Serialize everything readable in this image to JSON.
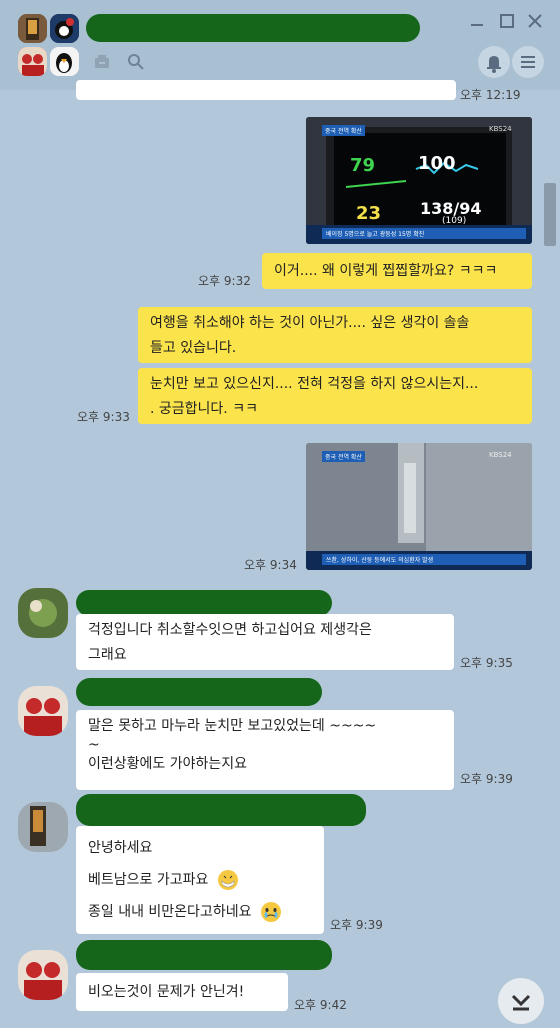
{
  "messages": [
    {
      "id": "m0",
      "type": "text",
      "side": "me",
      "text": "",
      "time": "오후 12:19"
    },
    {
      "id": "m1",
      "type": "image",
      "side": "me",
      "caption": "베이징 5명으로 늘고 광둥성 15명 확진",
      "channel": "KBS24",
      "tag": "중국 전역 확산",
      "values": {
        "hr": "79",
        "spo2": "100",
        "rr": "23",
        "bp": "138/94",
        "map": "(109)"
      }
    },
    {
      "id": "m2",
      "type": "text",
      "side": "me",
      "text": "이거.... 왜 이렇게 찝찝할까요? ㅋㅋㅋ",
      "time": "오후 9:32"
    },
    {
      "id": "m3",
      "type": "text",
      "side": "me",
      "lines": [
        "여행을 취소해야 하는 것이 아닌가.... 싶은 생각이 솔솔",
        "들고 있습니다."
      ]
    },
    {
      "id": "m4",
      "type": "text",
      "side": "me",
      "lines": [
        "눈치만 보고 있으신지.... 전혀 걱정을 하지 않으시는지...",
        ". 궁금합니다. ㅋㅋ"
      ],
      "time": "오후 9:33"
    },
    {
      "id": "m5",
      "type": "image",
      "side": "me",
      "caption": "쓰촨, 상하이, 산둥 등에서도 의심환자 발생",
      "channel": "KBS24",
      "tag": "중국 전역 확산",
      "time": "오후 9:34"
    },
    {
      "id": "m6",
      "type": "text",
      "side": "other",
      "lines": [
        "걱정입니다 취소할수잇으면 하고십어요  제생각은",
        "그래요"
      ],
      "time": "오후 9:35"
    },
    {
      "id": "m7",
      "type": "text",
      "side": "other",
      "lines": [
        "말은 못하고 마누라 눈치만 보고있었는데 ~~~~",
        "~",
        "이런상황에도 가야하는지요"
      ],
      "time": "오후 9:39"
    },
    {
      "id": "m8",
      "type": "text",
      "side": "other",
      "lines": [
        "안녕하세요",
        "베트남으로 가고파요",
        "종일 내내 비만온다고하네요"
      ],
      "emojis": [
        "mask-face-icon",
        "crying-face-icon"
      ],
      "time": "오후 9:39"
    },
    {
      "id": "m9",
      "type": "text",
      "side": "other",
      "text": "비오는것이 문제가 안닌겨!",
      "time": "오후 9:42"
    }
  ],
  "colors": {
    "background": "#b2c7d9",
    "my_bubble": "#fbe34c",
    "other_bubble": "#ffffff",
    "redaction": "#15661a"
  }
}
